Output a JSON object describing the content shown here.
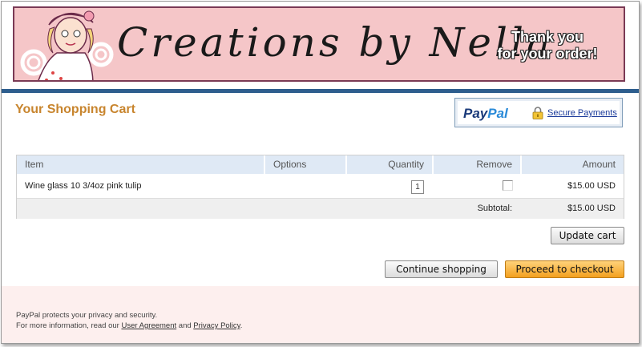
{
  "banner": {
    "shop_name": "Creations by Nella",
    "thanks_line1": "Thank you",
    "thanks_line2": "for your order!"
  },
  "header": {
    "title": "Your Shopping Cart",
    "paypal_logo_pay": "Pay",
    "paypal_logo_pal": "Pal",
    "secure_payments": "Secure Payments"
  },
  "table": {
    "columns": [
      "Item",
      "Options",
      "Quantity",
      "Remove",
      "Amount"
    ],
    "rows": [
      {
        "item": "Wine glass 10 3/4oz pink tulip",
        "options": "",
        "quantity": "1",
        "amount": "$15.00 USD"
      }
    ],
    "subtotal_label": "Subtotal:",
    "subtotal_value": "$15.00 USD"
  },
  "buttons": {
    "update_cart": "Update cart",
    "continue_shopping": "Continue shopping",
    "proceed_to_checkout": "Proceed to checkout"
  },
  "footer": {
    "line1": "PayPal protects your privacy and security.",
    "line2_prefix": "For more information, read our",
    "user_agreement": "User Agreement",
    "and": "and",
    "privacy_policy": "Privacy Policy",
    "period": "."
  },
  "colors": {
    "banner_bg": "#f5c6c8",
    "rule": "#2e5e8e",
    "title": "#c8852e",
    "checkout_button": "#f3a01f"
  }
}
